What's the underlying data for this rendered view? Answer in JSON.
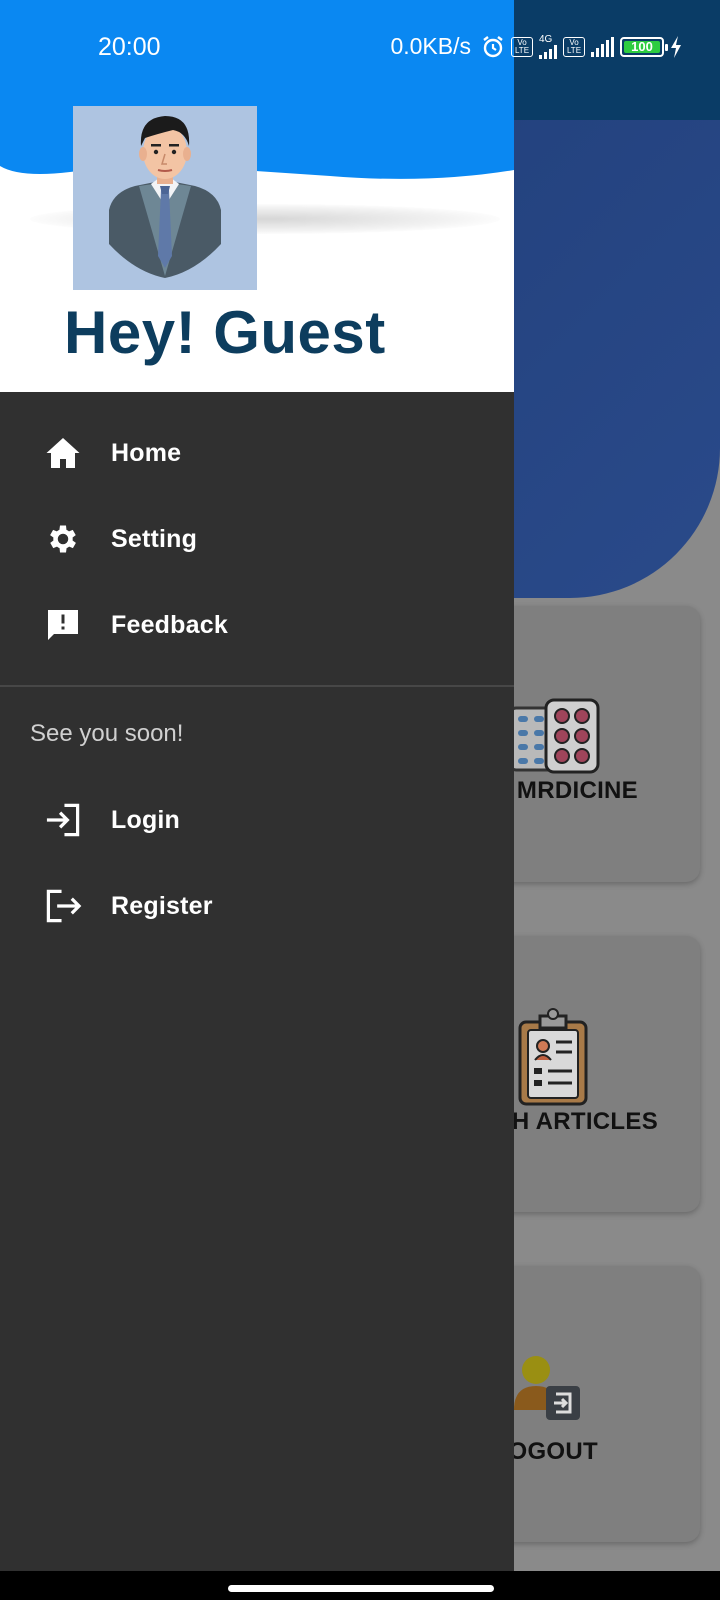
{
  "status_bar": {
    "time": "20:00",
    "net_speed": "0.0KB/s",
    "volte_1": "Vo LTE",
    "volte_2": "Vo LTE",
    "network_type": "4G",
    "battery_level": "100",
    "icons": [
      "alarm-icon",
      "volte-icon",
      "signal-4g-icon",
      "volte-icon",
      "signal-icon",
      "battery-icon",
      "charging-icon"
    ]
  },
  "drawer": {
    "greeting": "Hey! Guest",
    "avatar": "avatar-icon",
    "menu": [
      {
        "label": "Home",
        "icon": "home-icon"
      },
      {
        "label": "Setting",
        "icon": "gear-icon"
      },
      {
        "label": "Feedback",
        "icon": "feedback-icon"
      }
    ],
    "section_subtitle": "See you soon!",
    "auth_menu": [
      {
        "label": "Login",
        "icon": "login-icon"
      },
      {
        "label": "Register",
        "icon": "register-icon"
      }
    ]
  },
  "background": {
    "cards": [
      {
        "label": "MRDICINE",
        "icon": "pills-icon"
      },
      {
        "label": "H ARTICLES",
        "icon": "clipboard-icon"
      },
      {
        "label": "OGOUT",
        "icon": "logout-user-icon"
      }
    ]
  },
  "colors": {
    "header_blue": "#0a88f2",
    "drawer_bg": "#303030",
    "greeting_text": "#0d3d5e",
    "scrim_toolbar": "#0a3c66"
  }
}
